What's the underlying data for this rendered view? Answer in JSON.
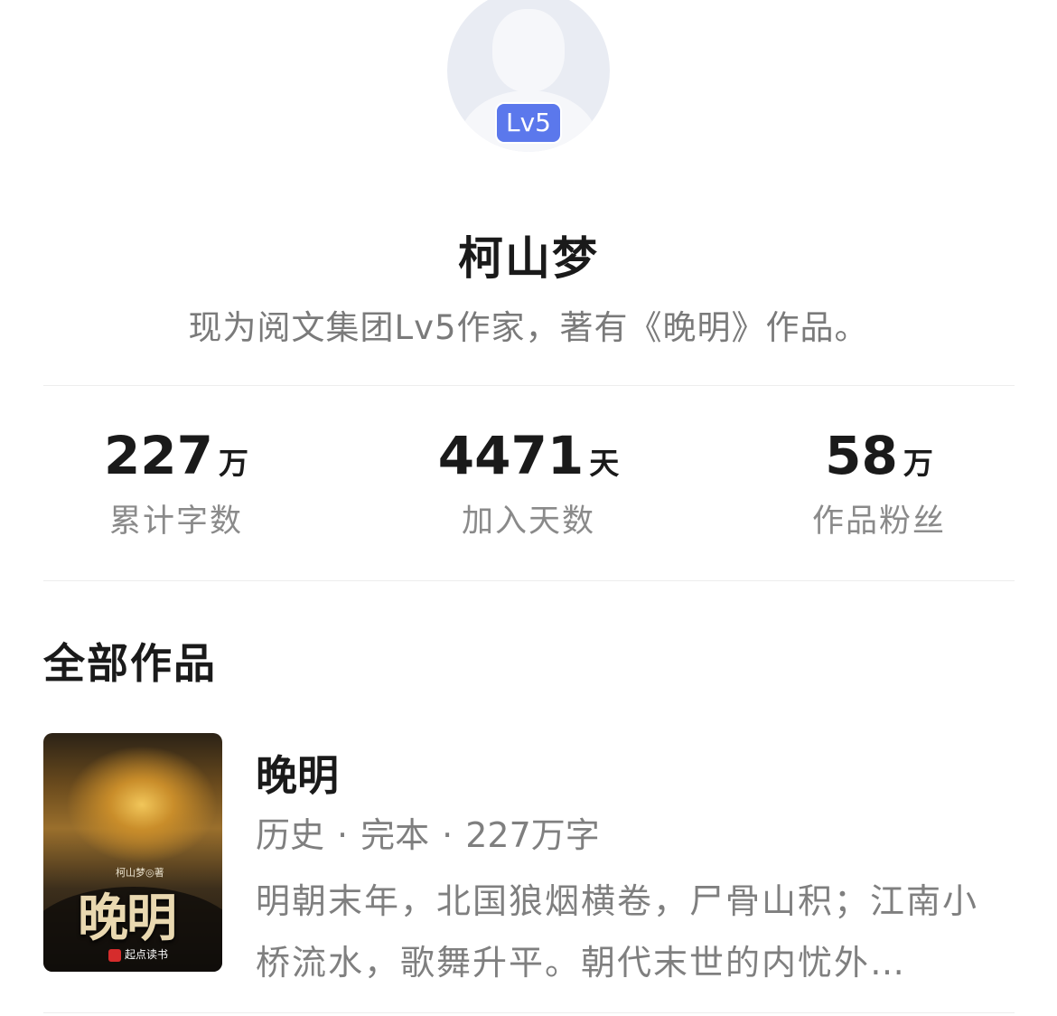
{
  "profile": {
    "level_badge": "Lv5",
    "name": "柯山梦",
    "bio": "现为阅文集团Lv5作家，著有《晚明》作品。"
  },
  "stats": [
    {
      "value": "227",
      "unit": "万",
      "label": "累计字数"
    },
    {
      "value": "4471",
      "unit": "天",
      "label": "加入天数"
    },
    {
      "value": "58",
      "unit": "万",
      "label": "作品粉丝"
    }
  ],
  "works": {
    "section_title": "全部作品",
    "items": [
      {
        "title": "晚明",
        "genre": "历史",
        "status": "完本",
        "word_count": "227万字",
        "separator": "·",
        "description": "明朝末年，北国狼烟横卷，尸骨山积；江南小桥流水，歌舞升平。朝代末世的内忧外…",
        "cover": {
          "title": "晚明",
          "author": "柯山梦◎著",
          "publisher": "起点读书"
        }
      }
    ]
  },
  "colors": {
    "badge": "#5b78ec",
    "text_primary": "#1a1a1a",
    "text_secondary": "#7f7f7f"
  }
}
